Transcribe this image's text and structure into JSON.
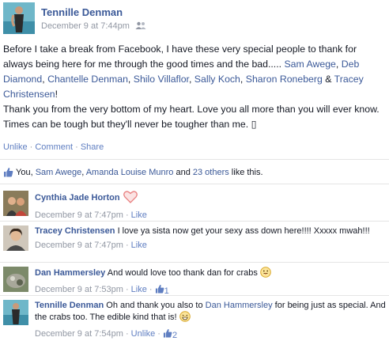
{
  "post": {
    "author": "Tennille Denman",
    "timestamp": "December 9 at 7:44pm",
    "audience_icon": "friends-icon",
    "line1": "Before I take a break from Facebook, I have these very special people to thank for always being here for me through the good times and the bad.....",
    "tags": [
      "Sam Awege",
      "Deb Diamond",
      "Chantelle Denman",
      "Shilo Villaflor",
      "Sally Koch",
      "Sharon Roneberg",
      "Tracey Christensen"
    ],
    "amp": "&",
    "bang": "!",
    "line3": "Thank you from the very bottom of my heart. Love you all more than you will ever know. Times can be tough but they'll never be tougher than me. ▯"
  },
  "actions": {
    "unlike": "Unlike",
    "comment": "Comment",
    "share": "Share",
    "dot": " · "
  },
  "likes": {
    "you": "You",
    "comma": ", ",
    "names": [
      "Sam Awege",
      "Amanda Louise Munro"
    ],
    "and": " and ",
    "others": "23 others",
    "suffix": " like this."
  },
  "comments": [
    {
      "name": "Cynthia Jade Horton",
      "text": "",
      "emoji": "heart-icon",
      "time": "December 9 at 7:47pm",
      "action": "Like",
      "likes": ""
    },
    {
      "name": "Tracey Christensen",
      "text": "I love ya sista now get your sexy ass down here!!!! Xxxxx mwah!!!",
      "time": "December 9 at 7:47pm",
      "action": "Like",
      "likes": ""
    },
    {
      "name": "Dan Hammersley",
      "text": "And would love too thank dan for crabs",
      "emoji": "tongue-emoji",
      "time": "December 9 at 7:53pm",
      "action": "Like",
      "likes": "1"
    },
    {
      "name": "Tennille Denman",
      "text_before": "Oh and thank you also to",
      "mention": "Dan Hammersley",
      "text_after": "for being just as special. And the crabs too. The edible kind that is!",
      "emoji": "grin-emoji",
      "time": "December 9 at 7:54pm",
      "action": "Unlike",
      "likes": "2"
    }
  ],
  "colors": {
    "link": "#3b5998",
    "meta": "#9197a3",
    "action": "#5f7ec1",
    "heart": "#f5a3a3"
  }
}
